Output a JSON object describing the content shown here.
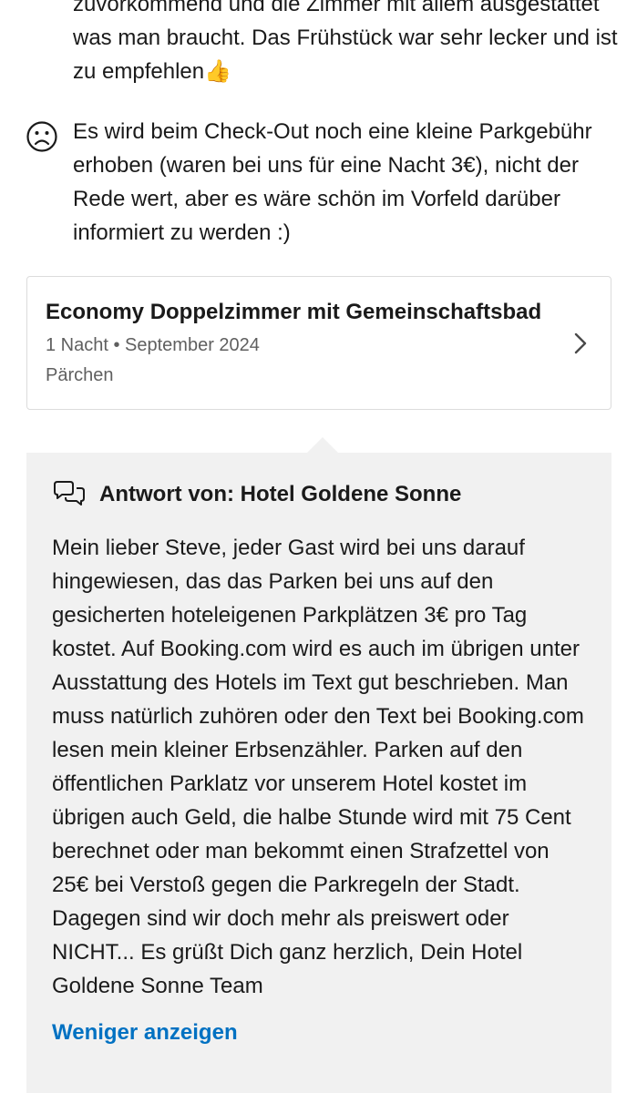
{
  "review": {
    "positive_text": "zuvorkommend und die Zimmer mit allem ausgestattet was man braucht. Das Frühstück war sehr lecker und ist zu empfehlen👍",
    "negative_text": "Es wird beim Check-Out noch eine kleine Parkgebühr erhoben (waren bei uns für eine Nacht 3€), nicht der Rede wert, aber es wäre schön im Vorfeld darüber informiert zu werden :)",
    "negative_icon": "sad-face-icon"
  },
  "room": {
    "title": "Economy Doppelzimmer mit Gemeinschaftsbad",
    "stay": "1 Nacht • September 2024",
    "traveler_type": "Pärchen"
  },
  "reply": {
    "icon": "speech-bubbles-icon",
    "title": "Antwort von: Hotel Goldene Sonne",
    "body": "Mein lieber Steve, jeder Gast wird bei uns darauf hingewiesen, das das Parken bei uns auf den gesicherten hoteleigenen Parkplätzen 3€ pro Tag kostet.  Auf Booking.com wird es auch im übrigen unter Ausstattung des Hotels im Text gut beschrieben. Man muss natürlich zuhören oder den Text bei Booking.com lesen mein kleiner Erbsenzähler. Parken auf den öffentlichen Parklatz vor unserem Hotel kostet im übrigen auch Geld, die halbe Stunde wird mit 75 Cent berechnet oder man bekommt einen Strafzettel von 25€ bei Verstoß gegen die Parkregeln der Stadt. Dagegen sind wir doch mehr als preiswert oder NICHT... Es grüßt Dich ganz herzlich, Dein Hotel Goldene Sonne Team",
    "show_less_label": "Weniger anzeigen"
  },
  "colors": {
    "link": "#0071c2",
    "reply_background": "#f1f1f1",
    "card_border": "#dcdcdc"
  }
}
